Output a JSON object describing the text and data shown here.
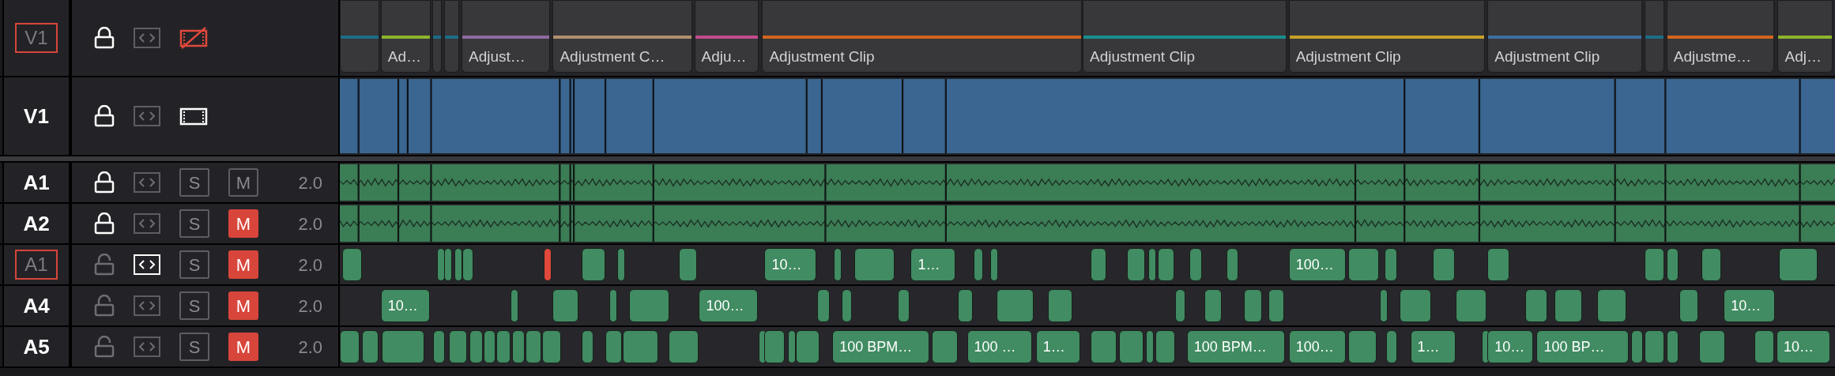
{
  "video_tracks": [
    {
      "name": "V1",
      "patched": true,
      "locked": true,
      "auto_select": false,
      "enabled": false,
      "kind": "adjustment",
      "clips": [
        {
          "color": "#1d6c86"
        },
        {
          "color": "#8db52a",
          "label": "Ad…"
        },
        {
          "color": "#1d6c86"
        },
        {
          "color": "#1d6c86"
        },
        {
          "color": "#8f6aa0",
          "label": "Adjust…"
        },
        {
          "color": "#b0906f",
          "label": "Adjustment C…"
        },
        {
          "color": "#c04c8c",
          "label": "Adju…"
        },
        {
          "color": "#d2641c",
          "label": "Adjustment Clip"
        },
        {
          "color": "#16908f",
          "label": "Adjustment Clip"
        },
        {
          "color": "#c8a028",
          "label": "Adjustment Clip"
        },
        {
          "color": "#3e6fa0",
          "label": "Adjustment Clip"
        },
        {
          "color": "#1d6c86"
        },
        {
          "color": "#d2641c",
          "label": "Adjustme…"
        },
        {
          "color": "#8db52a",
          "label": "Adj…"
        }
      ]
    },
    {
      "name": "V1",
      "patched": false,
      "locked": true,
      "auto_select": false,
      "enabled": true,
      "kind": "video"
    }
  ],
  "audio_tracks": [
    {
      "name": "A1",
      "patched": false,
      "locked": true,
      "auto_select": false,
      "solo": {
        "label": "S",
        "on": false
      },
      "mute": {
        "label": "M",
        "on": false
      },
      "channels": "2.0",
      "kind": "waveform"
    },
    {
      "name": "A2",
      "patched": false,
      "locked": true,
      "auto_select": false,
      "solo": {
        "label": "S",
        "on": false
      },
      "mute": {
        "label": "M",
        "on": true
      },
      "channels": "2.0",
      "kind": "waveform"
    },
    {
      "name": "A1",
      "patched": true,
      "locked": false,
      "auto_select": true,
      "solo": {
        "label": "S",
        "on": false
      },
      "mute": {
        "label": "M",
        "on": true
      },
      "channels": "2.0",
      "kind": "clips",
      "clips": [
        {
          "color": "#418c62"
        },
        {
          "color": "#418c62"
        },
        {
          "color": "#418c62"
        },
        {
          "color": "#418c62"
        },
        {
          "color": "#418c62"
        },
        {
          "color": "#e0483c"
        },
        {
          "color": "#418c62"
        },
        {
          "color": "#418c62"
        },
        {
          "color": "#418c62"
        },
        {
          "color": "#418c62",
          "label": "10…"
        },
        {
          "color": "#418c62"
        },
        {
          "color": "#418c62"
        },
        {
          "color": "#418c62",
          "label": "1…"
        },
        {
          "color": "#418c62"
        },
        {
          "color": "#418c62"
        },
        {
          "color": "#418c62"
        },
        {
          "color": "#418c62"
        },
        {
          "color": "#418c62"
        },
        {
          "color": "#418c62"
        },
        {
          "color": "#418c62"
        },
        {
          "color": "#418c62"
        },
        {
          "color": "#418c62",
          "label": "100…"
        },
        {
          "color": "#418c62"
        },
        {
          "color": "#418c62"
        },
        {
          "color": "#418c62"
        },
        {
          "color": "#418c62"
        },
        {
          "color": "#418c62"
        },
        {
          "color": "#418c62"
        },
        {
          "color": "#418c62"
        },
        {
          "color": "#418c62"
        }
      ]
    },
    {
      "name": "A4",
      "patched": false,
      "locked": false,
      "auto_select": false,
      "solo": {
        "label": "S",
        "on": false
      },
      "mute": {
        "label": "M",
        "on": true
      },
      "channels": "2.0",
      "kind": "clips",
      "clips": [
        {
          "color": "#418c62",
          "label": "10…"
        },
        {
          "color": "#418c62"
        },
        {
          "color": "#418c62"
        },
        {
          "color": "#418c62"
        },
        {
          "color": "#418c62"
        },
        {
          "color": "#418c62",
          "label": "100…"
        },
        {
          "color": "#418c62"
        },
        {
          "color": "#418c62"
        },
        {
          "color": "#418c62"
        },
        {
          "color": "#418c62"
        },
        {
          "color": "#418c62"
        },
        {
          "color": "#418c62"
        },
        {
          "color": "#418c62"
        },
        {
          "color": "#418c62"
        },
        {
          "color": "#418c62"
        },
        {
          "color": "#418c62"
        },
        {
          "color": "#418c62"
        },
        {
          "color": "#418c62"
        },
        {
          "color": "#418c62"
        },
        {
          "color": "#418c62"
        },
        {
          "color": "#418c62"
        },
        {
          "color": "#418c62"
        },
        {
          "color": "#418c62"
        },
        {
          "color": "#418c62",
          "label": "10…"
        }
      ]
    },
    {
      "name": "A5",
      "patched": false,
      "locked": false,
      "auto_select": false,
      "solo": {
        "label": "S",
        "on": false
      },
      "mute": {
        "label": "M",
        "on": true
      },
      "channels": "2.0",
      "kind": "clips",
      "clips": [
        {
          "color": "#418c62"
        },
        {
          "color": "#418c62"
        },
        {
          "color": "#418c62"
        },
        {
          "color": "#418c62"
        },
        {
          "color": "#418c62"
        },
        {
          "color": "#418c62"
        },
        {
          "color": "#418c62"
        },
        {
          "color": "#418c62"
        },
        {
          "color": "#418c62"
        },
        {
          "color": "#418c62"
        },
        {
          "color": "#418c62"
        },
        {
          "color": "#418c62"
        },
        {
          "color": "#418c62"
        },
        {
          "color": "#418c62"
        },
        {
          "color": "#418c62"
        },
        {
          "color": "#418c62"
        },
        {
          "color": "#418c62"
        },
        {
          "color": "#418c62"
        },
        {
          "color": "#418c62"
        },
        {
          "color": "#418c62",
          "label": "100 BPM…"
        },
        {
          "color": "#418c62"
        },
        {
          "color": "#418c62",
          "label": "100 …"
        },
        {
          "color": "#418c62",
          "label": "1…"
        },
        {
          "color": "#418c62"
        },
        {
          "color": "#418c62"
        },
        {
          "color": "#418c62"
        },
        {
          "color": "#418c62"
        },
        {
          "color": "#418c62",
          "label": "100 BPM…"
        },
        {
          "color": "#418c62",
          "label": "100…"
        },
        {
          "color": "#418c62"
        },
        {
          "color": "#418c62"
        },
        {
          "color": "#418c62",
          "label": "1…"
        },
        {
          "color": "#418c62"
        },
        {
          "color": "#418c62",
          "label": "10…"
        },
        {
          "color": "#418c62",
          "label": "100 BP…"
        },
        {
          "color": "#418c62"
        },
        {
          "color": "#418c62"
        },
        {
          "color": "#418c62"
        },
        {
          "color": "#418c62"
        },
        {
          "color": "#418c62"
        },
        {
          "color": "#418c62",
          "label": "10…"
        }
      ]
    }
  ]
}
